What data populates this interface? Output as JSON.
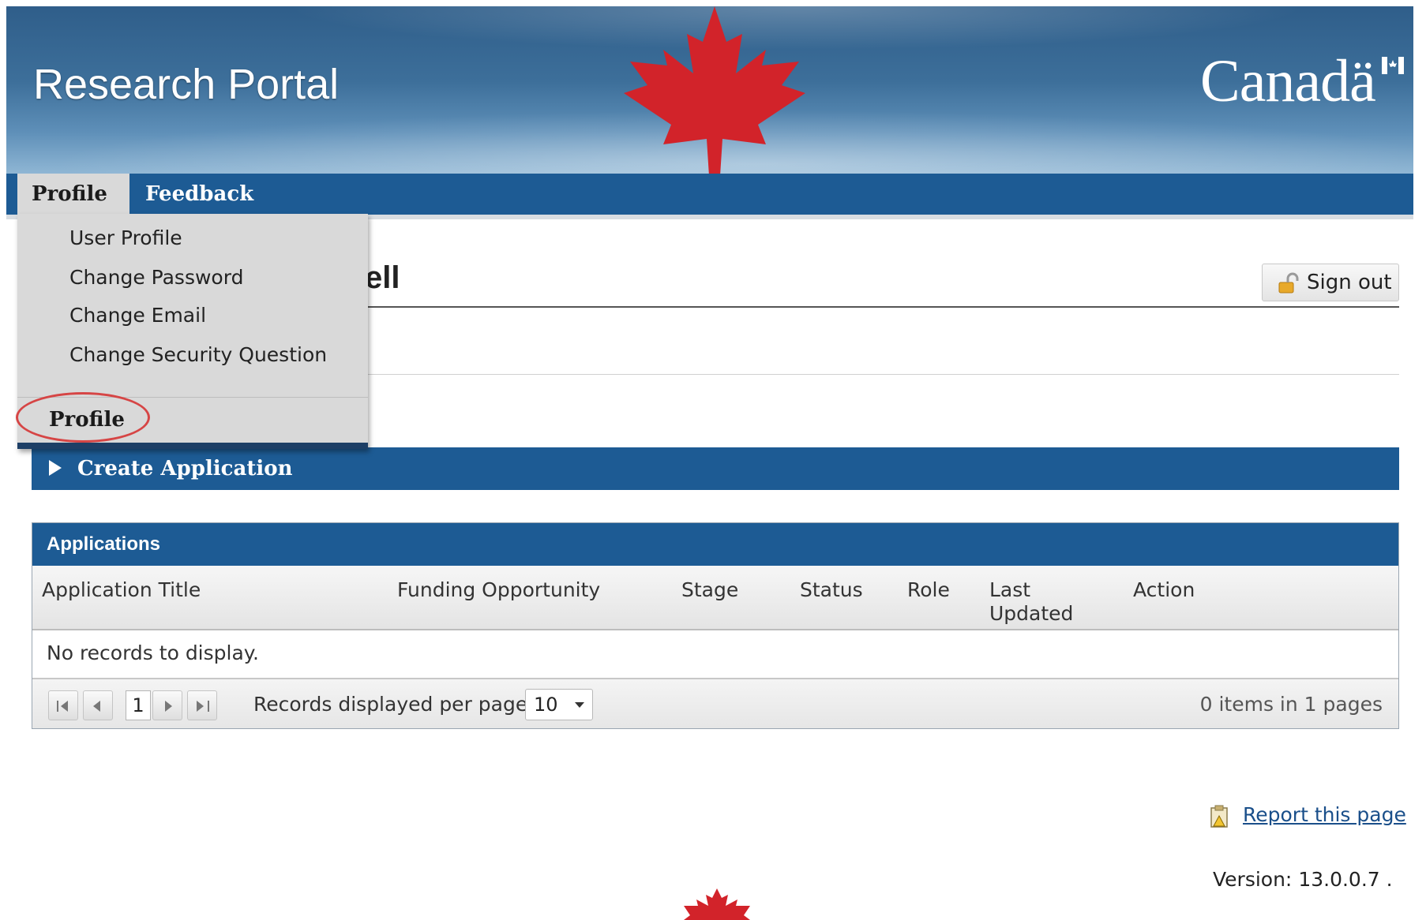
{
  "header": {
    "site_title": "Research Portal",
    "wordmark": "Canadä"
  },
  "nav": {
    "items": [
      {
        "label": "Profile"
      },
      {
        "label": "Feedback"
      }
    ]
  },
  "profile_menu": {
    "items": [
      {
        "label": "User Profile"
      },
      {
        "label": "Change Password"
      },
      {
        "label": "Change Email"
      },
      {
        "label": "Change Security Question"
      }
    ],
    "bottom_label": "Profile"
  },
  "main": {
    "heading_visible": "ell",
    "signout_label": "Sign out",
    "create_application_label": "Create Application"
  },
  "applications": {
    "title": "Applications",
    "columns": [
      "Application Title",
      "Funding Opportunity",
      "Stage",
      "Status",
      "Role",
      "Last",
      "Updated",
      "Action"
    ],
    "empty_message": "No records to display.",
    "pager": {
      "current_page": "1",
      "per_page_label": "Records displayed per page:",
      "per_page_value": "10",
      "summary": "0 items in 1 pages"
    }
  },
  "footer": {
    "report_link": "Report this page",
    "version_label": "Version:",
    "version_value": "13.0.0.7 ."
  },
  "colors": {
    "nav_blue": "#1d5b94",
    "menu_gray": "#d9d9d9",
    "maple_red": "#d2232a",
    "highlight_ellipse": "#d64545"
  }
}
